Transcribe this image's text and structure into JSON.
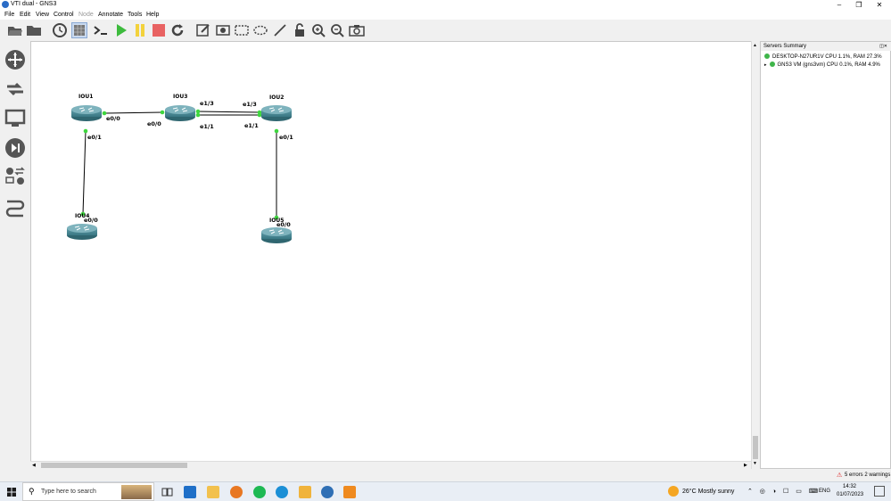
{
  "window": {
    "title": "VTI dual - GNS3",
    "minimize": "–",
    "restore": "❐",
    "close": "✕"
  },
  "menu": [
    "File",
    "Edit",
    "View",
    "Control",
    "Node",
    "Annotate",
    "Tools",
    "Help"
  ],
  "toolbar_icons": [
    "open-folder-icon",
    "folder-icon",
    "clock-icon",
    "snapshot-grid-icon",
    "console-icon",
    "start-icon",
    "pause-icon",
    "stop-icon",
    "reload-icon",
    "note-icon",
    "image-icon",
    "rectangle-icon",
    "ellipse-icon",
    "line-icon",
    "lock-icon",
    "zoom-in-icon",
    "zoom-out-icon",
    "screenshot-icon"
  ],
  "sidebar_icons": [
    "router-icon",
    "switch-icon",
    "end-device-icon",
    "security-icon",
    "all-devices-icon",
    "add-link-icon"
  ],
  "topology": {
    "nodes": [
      {
        "id": "IOU1",
        "label": "IOU1"
      },
      {
        "id": "IOU3",
        "label": "IOU3"
      },
      {
        "id": "IOU2",
        "label": "IOU2"
      },
      {
        "id": "IOU4",
        "label": "IOU4"
      },
      {
        "id": "IOU5",
        "label": "IOU5"
      }
    ],
    "ports": {
      "iou1_e00": "e0/0",
      "iou3_e00": "e0/0",
      "iou3_e13": "e1/3",
      "iou3_e11": "e1/1",
      "iou2_e13": "e1/3",
      "iou2_e11": "e1/1",
      "iou1_e01": "e0/1",
      "iou4_e00": "e0/0",
      "iou2_e01": "e0/1",
      "iou5_e00": "e0/0"
    }
  },
  "servers": {
    "title": "Servers Summary",
    "items": [
      {
        "name": "DESKTOP-N27UR1V CPU 1.1%, RAM 27.3%"
      },
      {
        "name": "GNS3 VM (gns3vm) CPU 0.1%, RAM 4.9%"
      }
    ]
  },
  "status": {
    "warnings": "5 errors 2 warnings"
  },
  "taskbar": {
    "search_placeholder": "Type here to search",
    "weather": "26°C  Mostly sunny",
    "lang": "ENG",
    "time": "14:32",
    "date": "01/07/2023"
  }
}
